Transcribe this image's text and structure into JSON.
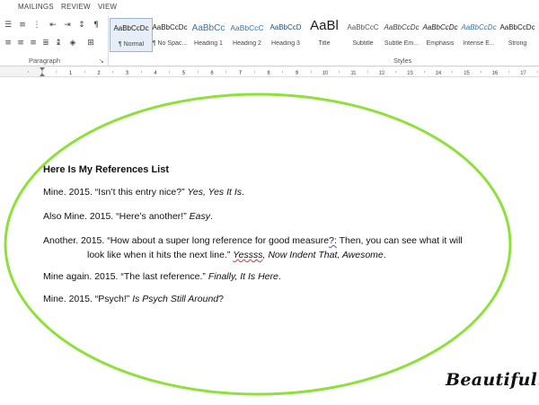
{
  "tabs": [
    "MAILINGS",
    "REVIEW",
    "VIEW"
  ],
  "groups": {
    "paragraph": "Paragraph",
    "styles": "Styles"
  },
  "styles": [
    {
      "sample": "AaBbCcDc",
      "name": "¶ Normal",
      "color": "#1a1a1a",
      "size": 8,
      "italic": false,
      "selected": true
    },
    {
      "sample": "AaBbCcDc",
      "name": "¶ No Spac...",
      "color": "#1a1a1a",
      "size": 8,
      "italic": false,
      "selected": false
    },
    {
      "sample": "AaBbCc",
      "name": "Heading 1",
      "color": "#2e74b5",
      "size": 10,
      "italic": false,
      "selected": false
    },
    {
      "sample": "AaBbCcC",
      "name": "Heading 2",
      "color": "#2e74b5",
      "size": 8.5,
      "italic": false,
      "selected": false
    },
    {
      "sample": "AaBbCcD",
      "name": "Heading 3",
      "color": "#1f4e79",
      "size": 8,
      "italic": false,
      "selected": false
    },
    {
      "sample": "AaBl",
      "name": "Title",
      "color": "#1a1a1a",
      "size": 15,
      "italic": false,
      "selected": false
    },
    {
      "sample": "AaBbCcC",
      "name": "Subtitle",
      "color": "#595959",
      "size": 8,
      "italic": false,
      "selected": false
    },
    {
      "sample": "AaBbCcDc",
      "name": "Subtle Em...",
      "color": "#404040",
      "size": 8,
      "italic": true,
      "selected": false
    },
    {
      "sample": "AaBbCcDc",
      "name": "Emphasis",
      "color": "#1a1a1a",
      "size": 8,
      "italic": true,
      "selected": false
    },
    {
      "sample": "AaBbCcDc",
      "name": "Intense E...",
      "color": "#2e74b5",
      "size": 8,
      "italic": true,
      "selected": false
    },
    {
      "sample": "AaBbCcDc",
      "name": "Strong",
      "color": "#1a1a1a",
      "size": 8,
      "italic": false,
      "selected": false
    }
  ],
  "ruler_numbers": [
    "1",
    "2",
    "3",
    "4",
    "5",
    "6",
    "7",
    "8",
    "9",
    "10",
    "11",
    "12",
    "13",
    "14",
    "15",
    "16",
    "17"
  ],
  "document": {
    "heading": "Here Is My References List",
    "refs": [
      {
        "a": "Mine. 2015. “Isn’t this entry nice?” ",
        "b": "Yes, Yes It Is",
        "c": "."
      },
      {
        "a": "Also Mine. 2015. “Here’s another!” ",
        "b": "Easy",
        "c": "."
      },
      {
        "a": "Another. 2015. “How about a super long reference for good measure",
        "sq": "?:",
        "a2": " Then, you can see what it will"
      },
      {
        "a": "look like when it hits the next line.” ",
        "sq": "Yessss",
        "b": ", Now Indent That, Awesome",
        "c": "."
      },
      {
        "a": "Mine again. 2015. “The last reference.” ",
        "b": "Finally, It Is Here",
        "c": "."
      },
      {
        "a": "Mine. 2015. “Psych!” ",
        "b": "Is Psych Still Around",
        "c": "?"
      }
    ]
  },
  "ellipse_color": "#8ee03a",
  "caption": "Beautiful."
}
